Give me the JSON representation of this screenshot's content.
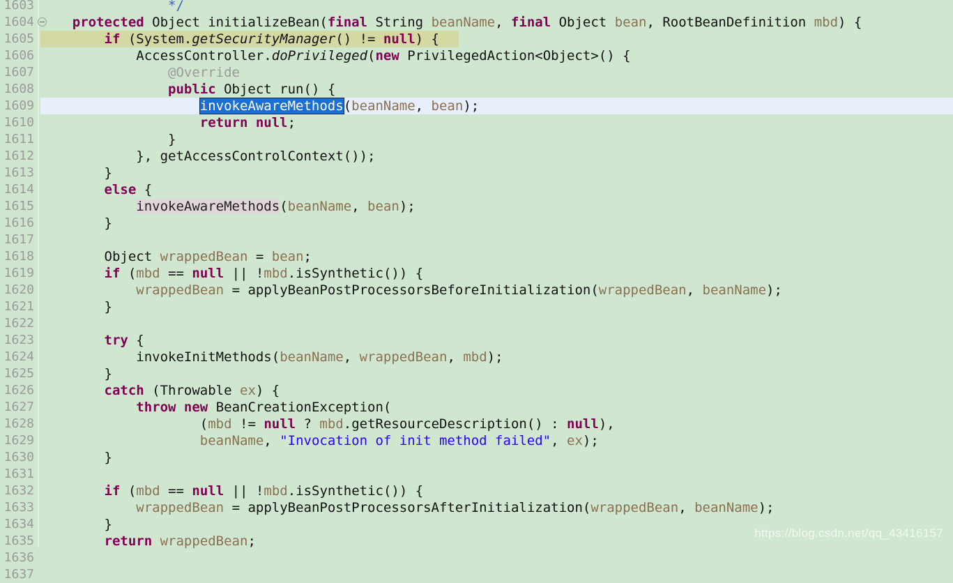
{
  "editor": {
    "app": "eclipse-java-editor",
    "theme_background": "#cfe7cf",
    "gutter_color": "#9a9a9a",
    "current_line_highlight": "#e7effc",
    "search_match_highlight": "#d5d8a0",
    "selection_color": "#1a6fd4",
    "occurrence_highlight": "#e0d6dc",
    "first_line_number": 1603,
    "last_line_number": 1637,
    "line_count": 35,
    "selected_text": "invokeAwareMethods",
    "fold_marker_line": 1604,
    "watermark": "https://blog.csdn.net/qq_43416157"
  },
  "lines": [
    {
      "n": "1603",
      "indent": 4,
      "tokens": [
        {
          "t": "*/",
          "c": "jdoc"
        }
      ]
    },
    {
      "n": "1604",
      "fold": true,
      "indent": 1,
      "tokens": [
        {
          "t": "protected ",
          "c": "kw"
        },
        {
          "t": "Object ",
          "c": "plain"
        },
        {
          "t": "initializeBean",
          "c": "plain"
        },
        {
          "t": "(",
          "c": "op"
        },
        {
          "t": "final ",
          "c": "kw"
        },
        {
          "t": "String ",
          "c": "plain"
        },
        {
          "t": "beanName",
          "c": "param"
        },
        {
          "t": ", ",
          "c": "op"
        },
        {
          "t": "final ",
          "c": "kw"
        },
        {
          "t": "Object ",
          "c": "plain"
        },
        {
          "t": "bean",
          "c": "param"
        },
        {
          "t": ", ",
          "c": "op"
        },
        {
          "t": "RootBeanDefinition ",
          "c": "plain"
        },
        {
          "t": "mbd",
          "c": "param"
        },
        {
          "t": ") {",
          "c": "op"
        }
      ]
    },
    {
      "n": "1605",
      "highlight": "search",
      "hl_width": 600,
      "indent": 2,
      "tokens": [
        {
          "t": "if ",
          "c": "kw"
        },
        {
          "t": "(System.",
          "c": "plain"
        },
        {
          "t": "getSecurityManager",
          "c": "statmeth"
        },
        {
          "t": "() != ",
          "c": "op"
        },
        {
          "t": "null",
          "c": "kw"
        },
        {
          "t": ") {",
          "c": "op"
        }
      ]
    },
    {
      "n": "1606",
      "indent": 3,
      "tokens": [
        {
          "t": "AccessController.",
          "c": "plain"
        },
        {
          "t": "doPrivileged",
          "c": "statmeth"
        },
        {
          "t": "(",
          "c": "op"
        },
        {
          "t": "new ",
          "c": "kw"
        },
        {
          "t": "PrivilegedAction<Object>() {",
          "c": "plain"
        }
      ]
    },
    {
      "n": "1607",
      "indent": 4,
      "tokens": [
        {
          "t": "@Override",
          "c": "annot"
        }
      ]
    },
    {
      "n": "1608",
      "indent": 4,
      "tokens": [
        {
          "t": "public ",
          "c": "kw"
        },
        {
          "t": "Object run() {",
          "c": "plain"
        }
      ]
    },
    {
      "n": "1609",
      "highlight": "current",
      "indent": 5,
      "tokens": [
        {
          "t": "invokeAwareMethods",
          "c": "sel"
        },
        {
          "t": "(",
          "c": "op"
        },
        {
          "t": "beanName",
          "c": "param"
        },
        {
          "t": ", ",
          "c": "op"
        },
        {
          "t": "bean",
          "c": "param"
        },
        {
          "t": ");",
          "c": "op"
        }
      ]
    },
    {
      "n": "1610",
      "indent": 5,
      "tokens": [
        {
          "t": "return ",
          "c": "kw"
        },
        {
          "t": "null",
          "c": "kw"
        },
        {
          "t": ";",
          "c": "op"
        }
      ]
    },
    {
      "n": "1611",
      "indent": 4,
      "tokens": [
        {
          "t": "}",
          "c": "op"
        }
      ]
    },
    {
      "n": "1612",
      "indent": 3,
      "tokens": [
        {
          "t": "}, getAccessControlContext());",
          "c": "plain"
        }
      ]
    },
    {
      "n": "1613",
      "indent": 2,
      "tokens": [
        {
          "t": "}",
          "c": "op"
        }
      ]
    },
    {
      "n": "1614",
      "indent": 2,
      "tokens": [
        {
          "t": "else ",
          "c": "kw"
        },
        {
          "t": "{",
          "c": "op"
        }
      ]
    },
    {
      "n": "1615",
      "indent": 3,
      "tokens": [
        {
          "t": "invokeAwareMethods",
          "c": "occ"
        },
        {
          "t": "(",
          "c": "op"
        },
        {
          "t": "beanName",
          "c": "param"
        },
        {
          "t": ", ",
          "c": "op"
        },
        {
          "t": "bean",
          "c": "param"
        },
        {
          "t": ");",
          "c": "op"
        }
      ]
    },
    {
      "n": "1616",
      "indent": 2,
      "tokens": [
        {
          "t": "}",
          "c": "op"
        }
      ]
    },
    {
      "n": "1617",
      "indent": 0,
      "tokens": []
    },
    {
      "n": "1618",
      "indent": 2,
      "tokens": [
        {
          "t": "Object ",
          "c": "plain"
        },
        {
          "t": "wrappedBean",
          "c": "localvar"
        },
        {
          "t": " = ",
          "c": "op"
        },
        {
          "t": "bean",
          "c": "param"
        },
        {
          "t": ";",
          "c": "op"
        }
      ]
    },
    {
      "n": "1619",
      "indent": 2,
      "tokens": [
        {
          "t": "if ",
          "c": "kw"
        },
        {
          "t": "(",
          "c": "op"
        },
        {
          "t": "mbd",
          "c": "param"
        },
        {
          "t": " == ",
          "c": "op"
        },
        {
          "t": "null",
          "c": "kw"
        },
        {
          "t": " || ",
          "c": "op"
        },
        {
          "t": "!",
          "c": "op"
        },
        {
          "t": "mbd",
          "c": "param"
        },
        {
          "t": ".isSynthetic()) {",
          "c": "plain"
        }
      ]
    },
    {
      "n": "1620",
      "indent": 3,
      "tokens": [
        {
          "t": "wrappedBean",
          "c": "localvar"
        },
        {
          "t": " = ",
          "c": "op"
        },
        {
          "t": "applyBeanPostProcessorsBeforeInitialization(",
          "c": "plain"
        },
        {
          "t": "wrappedBean",
          "c": "localvar"
        },
        {
          "t": ", ",
          "c": "op"
        },
        {
          "t": "beanName",
          "c": "param"
        },
        {
          "t": ");",
          "c": "op"
        }
      ]
    },
    {
      "n": "1621",
      "indent": 2,
      "tokens": [
        {
          "t": "}",
          "c": "op"
        }
      ]
    },
    {
      "n": "1622",
      "indent": 0,
      "tokens": []
    },
    {
      "n": "1623",
      "indent": 2,
      "tokens": [
        {
          "t": "try ",
          "c": "kw"
        },
        {
          "t": "{",
          "c": "op"
        }
      ]
    },
    {
      "n": "1624",
      "indent": 3,
      "tokens": [
        {
          "t": "invokeInitMethods(",
          "c": "plain"
        },
        {
          "t": "beanName",
          "c": "param"
        },
        {
          "t": ", ",
          "c": "op"
        },
        {
          "t": "wrappedBean",
          "c": "localvar"
        },
        {
          "t": ", ",
          "c": "op"
        },
        {
          "t": "mbd",
          "c": "param"
        },
        {
          "t": ");",
          "c": "op"
        }
      ]
    },
    {
      "n": "1625",
      "indent": 2,
      "tokens": [
        {
          "t": "}",
          "c": "op"
        }
      ]
    },
    {
      "n": "1626",
      "indent": 2,
      "tokens": [
        {
          "t": "catch ",
          "c": "kw"
        },
        {
          "t": "(Throwable ",
          "c": "plain"
        },
        {
          "t": "ex",
          "c": "param"
        },
        {
          "t": ") {",
          "c": "op"
        }
      ]
    },
    {
      "n": "1627",
      "indent": 3,
      "tokens": [
        {
          "t": "throw ",
          "c": "kw"
        },
        {
          "t": "new ",
          "c": "kw"
        },
        {
          "t": "BeanCreationException(",
          "c": "plain"
        }
      ]
    },
    {
      "n": "1628",
      "indent": 5,
      "tokens": [
        {
          "t": "(",
          "c": "op"
        },
        {
          "t": "mbd",
          "c": "param"
        },
        {
          "t": " != ",
          "c": "op"
        },
        {
          "t": "null",
          "c": "kw"
        },
        {
          "t": " ? ",
          "c": "op"
        },
        {
          "t": "mbd",
          "c": "param"
        },
        {
          "t": ".getResourceDescription() : ",
          "c": "plain"
        },
        {
          "t": "null",
          "c": "kw"
        },
        {
          "t": "),",
          "c": "op"
        }
      ]
    },
    {
      "n": "1629",
      "indent": 5,
      "tokens": [
        {
          "t": "beanName",
          "c": "param"
        },
        {
          "t": ", ",
          "c": "op"
        },
        {
          "t": "\"Invocation of init method failed\"",
          "c": "str"
        },
        {
          "t": ", ",
          "c": "op"
        },
        {
          "t": "ex",
          "c": "param"
        },
        {
          "t": ");",
          "c": "op"
        }
      ]
    },
    {
      "n": "1630",
      "indent": 2,
      "tokens": [
        {
          "t": "}",
          "c": "op"
        }
      ]
    },
    {
      "n": "1631",
      "indent": 0,
      "tokens": []
    },
    {
      "n": "1632",
      "indent": 2,
      "tokens": [
        {
          "t": "if ",
          "c": "kw"
        },
        {
          "t": "(",
          "c": "op"
        },
        {
          "t": "mbd",
          "c": "param"
        },
        {
          "t": " == ",
          "c": "op"
        },
        {
          "t": "null",
          "c": "kw"
        },
        {
          "t": " || ",
          "c": "op"
        },
        {
          "t": "!",
          "c": "op"
        },
        {
          "t": "mbd",
          "c": "param"
        },
        {
          "t": ".isSynthetic()) {",
          "c": "plain"
        }
      ]
    },
    {
      "n": "1633",
      "indent": 3,
      "tokens": [
        {
          "t": "wrappedBean",
          "c": "localvar"
        },
        {
          "t": " = ",
          "c": "op"
        },
        {
          "t": "applyBeanPostProcessorsAfterInitialization(",
          "c": "plain"
        },
        {
          "t": "wrappedBean",
          "c": "localvar"
        },
        {
          "t": ", ",
          "c": "op"
        },
        {
          "t": "beanName",
          "c": "param"
        },
        {
          "t": ");",
          "c": "op"
        }
      ]
    },
    {
      "n": "1634",
      "indent": 2,
      "tokens": [
        {
          "t": "}",
          "c": "op"
        }
      ]
    },
    {
      "n": "1635",
      "indent": 2,
      "tokens": [
        {
          "t": "return ",
          "c": "kw"
        },
        {
          "t": "wrappedBean",
          "c": "localvar"
        },
        {
          "t": ";",
          "c": "op"
        }
      ]
    },
    {
      "n": "1636",
      "indent": 1,
      "tokens": [
        {
          "t": "}",
          "c": "op"
        }
      ]
    },
    {
      "n": "1637",
      "indent": 0,
      "tokens": []
    }
  ]
}
